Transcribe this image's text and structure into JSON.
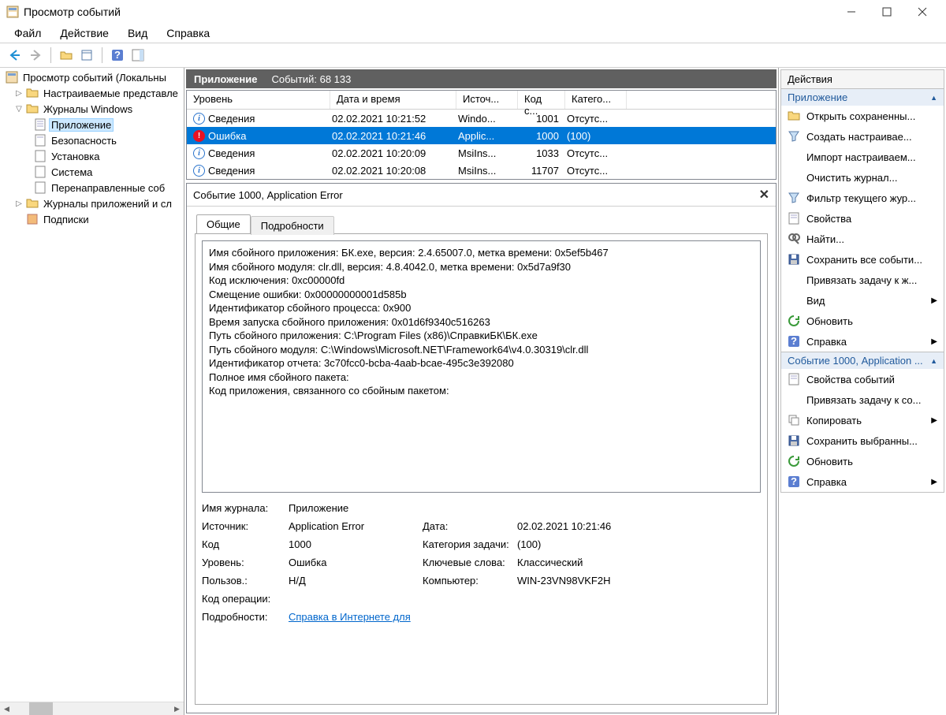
{
  "window": {
    "title": "Просмотр событий"
  },
  "menu": {
    "file": "Файл",
    "action": "Действие",
    "view": "Вид",
    "help": "Справка"
  },
  "tree": {
    "root": "Просмотр событий (Локальны",
    "custom": "Настраиваемые представле",
    "winlogs": "Журналы Windows",
    "application": "Приложение",
    "security": "Безопасность",
    "setup": "Установка",
    "system": "Система",
    "forwarded": "Перенаправленные соб",
    "applogs": "Журналы приложений и сл",
    "subs": "Подписки"
  },
  "center": {
    "title": "Приложение",
    "count_label": "Событий: 68 133",
    "columns": {
      "level": "Уровень",
      "date": "Дата и время",
      "source": "Источ...",
      "eid": "Код с...",
      "cat": "Катего..."
    },
    "rows": [
      {
        "level_icon": "info",
        "level": "Сведения",
        "date": "02.02.2021 10:21:52",
        "source": "Windo...",
        "eid": "1001",
        "cat": "Отсутс..."
      },
      {
        "level_icon": "error",
        "level": "Ошибка",
        "date": "02.02.2021 10:21:46",
        "source": "Applic...",
        "eid": "1000",
        "cat": "(100)",
        "selected": true
      },
      {
        "level_icon": "info",
        "level": "Сведения",
        "date": "02.02.2021 10:20:09",
        "source": "MsiIns...",
        "eid": "1033",
        "cat": "Отсутс..."
      },
      {
        "level_icon": "info",
        "level": "Сведения",
        "date": "02.02.2021 10:20:08",
        "source": "MsiIns...",
        "eid": "11707",
        "cat": "Отсутс..."
      }
    ]
  },
  "detail": {
    "title": "Событие 1000, Application Error",
    "tabs": {
      "general": "Общие",
      "details": "Подробности"
    },
    "description": [
      "Имя сбойного приложения: БК.exe, версия: 2.4.65007.0, метка времени: 0x5ef5b467",
      "Имя сбойного модуля: clr.dll, версия: 4.8.4042.0, метка времени: 0x5d7a9f30",
      "Код исключения: 0xc00000fd",
      "Смещение ошибки: 0x00000000001d585b",
      "Идентификатор сбойного процесса: 0x900",
      "Время запуска сбойного приложения: 0x01d6f9340c516263",
      "Путь сбойного приложения: C:\\Program Files (x86)\\СправкиБК\\БК.exe",
      "Путь сбойного модуля: C:\\Windows\\Microsoft.NET\\Framework64\\v4.0.30319\\clr.dll",
      "Идентификатор отчета: 3c70fcc0-bcba-4aab-bcae-495c3e392080",
      "Полное имя сбойного пакета:",
      "Код приложения, связанного со сбойным пакетом:"
    ],
    "props": {
      "log_lbl": "Имя журнала:",
      "log_val": "Приложение",
      "source_lbl": "Источник:",
      "source_val": "Application Error",
      "date_lbl": "Дата:",
      "date_val": "02.02.2021 10:21:46",
      "eid_lbl": "Код",
      "eid_val": "1000",
      "cat_lbl": "Категория задачи:",
      "cat_val": "(100)",
      "level_lbl": "Уровень:",
      "level_val": "Ошибка",
      "kw_lbl": "Ключевые слова:",
      "kw_val": "Классический",
      "user_lbl": "Пользов.:",
      "user_val": "Н/Д",
      "comp_lbl": "Компьютер:",
      "comp_val": "WIN-23VN98VKF2H",
      "opcode_lbl": "Код операции:",
      "more_lbl": "Подробности:",
      "more_link": "Справка в Интернете для"
    }
  },
  "actions": {
    "title": "Действия",
    "section1": "Приложение",
    "items1": [
      {
        "icon": "open",
        "label": "Открыть сохраненны..."
      },
      {
        "icon": "filter",
        "label": "Создать настраивае..."
      },
      {
        "icon": "",
        "label": "Импорт настраиваем..."
      },
      {
        "icon": "",
        "label": "Очистить журнал..."
      },
      {
        "icon": "filter",
        "label": "Фильтр текущего жур..."
      },
      {
        "icon": "props",
        "label": "Свойства"
      },
      {
        "icon": "find",
        "label": "Найти..."
      },
      {
        "icon": "save",
        "label": "Сохранить все событи..."
      },
      {
        "icon": "",
        "label": "Привязать задачу к ж..."
      },
      {
        "icon": "",
        "label": "Вид",
        "submenu": true
      },
      {
        "icon": "refresh",
        "label": "Обновить"
      },
      {
        "icon": "help",
        "label": "Справка",
        "submenu": true
      }
    ],
    "section2": "Событие 1000, Application ...",
    "items2": [
      {
        "icon": "props",
        "label": "Свойства событий"
      },
      {
        "icon": "",
        "label": "Привязать задачу к со..."
      },
      {
        "icon": "copy",
        "label": "Копировать",
        "submenu": true
      },
      {
        "icon": "save",
        "label": "Сохранить выбранны..."
      },
      {
        "icon": "refresh",
        "label": "Обновить"
      },
      {
        "icon": "help",
        "label": "Справка",
        "submenu": true
      }
    ]
  }
}
